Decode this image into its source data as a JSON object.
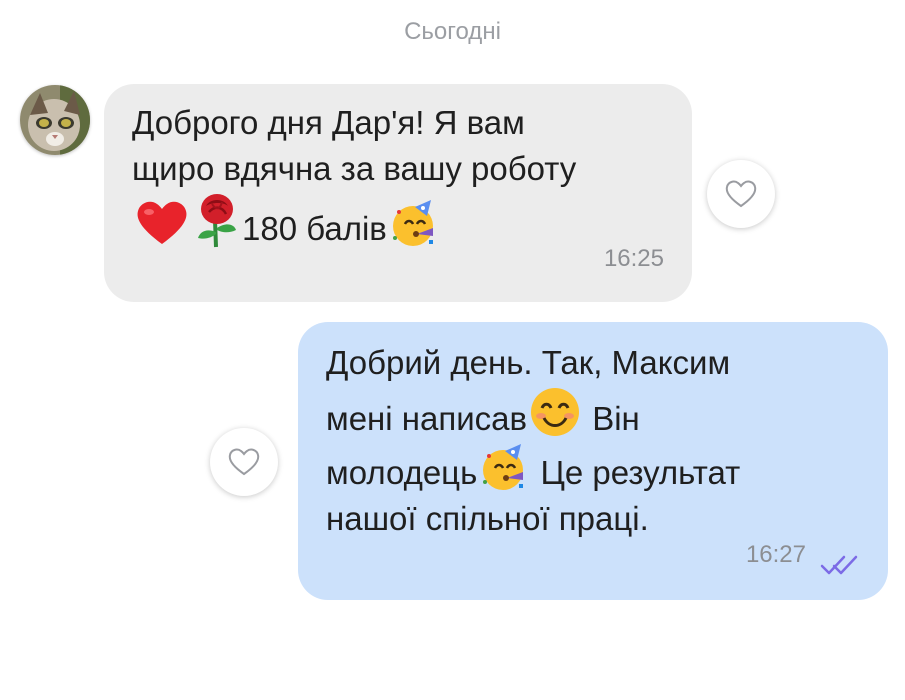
{
  "date_divider": "Сьогодні",
  "messages": [
    {
      "direction": "incoming",
      "lines": [
        "Доброго дня Дар'я! Я вам",
        "щиро вдячна за вашу роботу",
        "180 балів"
      ],
      "emojis": [
        "red-heart",
        "rose",
        "partying-face"
      ],
      "time": "16:25"
    },
    {
      "direction": "outgoing",
      "line1": "Добрий день. Так, Максим",
      "line2a": "мені написав",
      "line2b": "Він",
      "line3a": "молодець",
      "line3b": "Це результат",
      "line4": "нашої спільної праці.",
      "emojis": [
        "smiling-face",
        "partying-face"
      ],
      "time": "16:27",
      "status": "read"
    }
  ],
  "colors": {
    "incoming_bubble": "#ececec",
    "outgoing_bubble": "#cce1fb",
    "read_ticks": "#7c6be6",
    "timestamp": "#8c8e92"
  }
}
